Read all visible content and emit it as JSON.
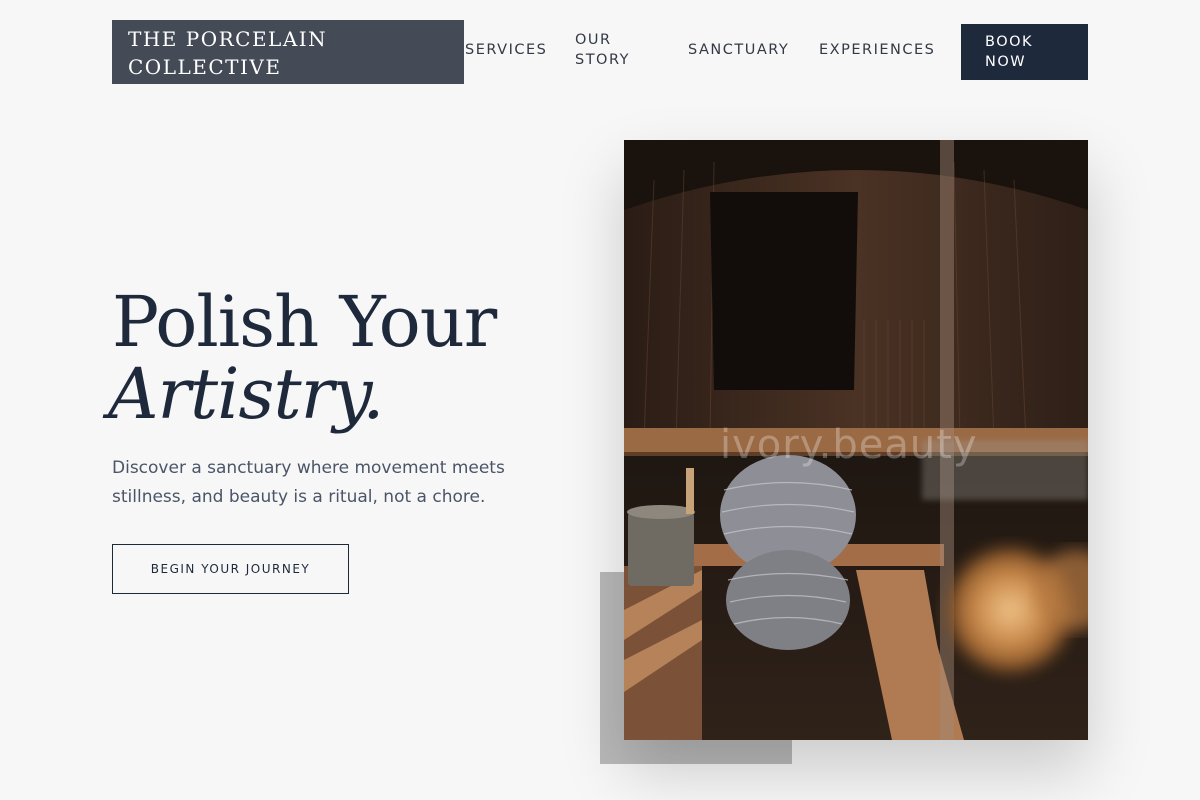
{
  "header": {
    "brand": [
      "THE PORCELAIN",
      "COLLECTIVE"
    ],
    "nav": {
      "services": [
        "SERVICES"
      ],
      "our_story": [
        "OUR",
        "STORY"
      ],
      "sanctuary": [
        "SANCTUARY"
      ],
      "experiences": [
        "EXPERIENCES"
      ]
    },
    "book_button": [
      "BOOK",
      "NOW"
    ]
  },
  "hero": {
    "title_line1": "Polish Your",
    "title_line2": "Artistry.",
    "subtitle": "Discover a sanctuary where movement meets stillness, and beauty is a ritual, not a chore.",
    "cta_label": "BEGIN YOUR JOURNEY"
  },
  "image": {
    "subject": "sauna-interior-photo",
    "watermark": "ivory.beauty"
  },
  "colors": {
    "primary_navy": "#1e293b",
    "brand_block": "#444b57",
    "page_background": "#f7f7f8",
    "body_text": "#4a5566",
    "accent_gray_block": "#b9b9b9"
  }
}
